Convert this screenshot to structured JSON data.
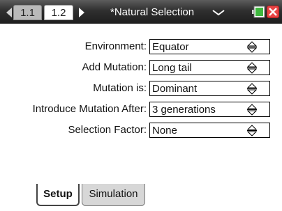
{
  "header": {
    "tabs": [
      {
        "label": "1.1"
      },
      {
        "label": "1.2"
      }
    ],
    "document_title": "*Natural Selection"
  },
  "form": {
    "rows": [
      {
        "label": "Environment:",
        "value": "Equator"
      },
      {
        "label": "Add Mutation:",
        "value": "Long tail"
      },
      {
        "label": "Mutation is:",
        "value": "Dominant"
      },
      {
        "label": "Introduce Mutation After:",
        "value": "3 generations"
      },
      {
        "label": "Selection Factor:",
        "value": "None"
      }
    ]
  },
  "bottom_tabs": [
    {
      "label": "Setup",
      "active": true
    },
    {
      "label": "Simulation",
      "active": false
    }
  ],
  "colors": {
    "topbar": "#2f2f2f",
    "close": "#e84444",
    "battery": "#3fb83f"
  }
}
